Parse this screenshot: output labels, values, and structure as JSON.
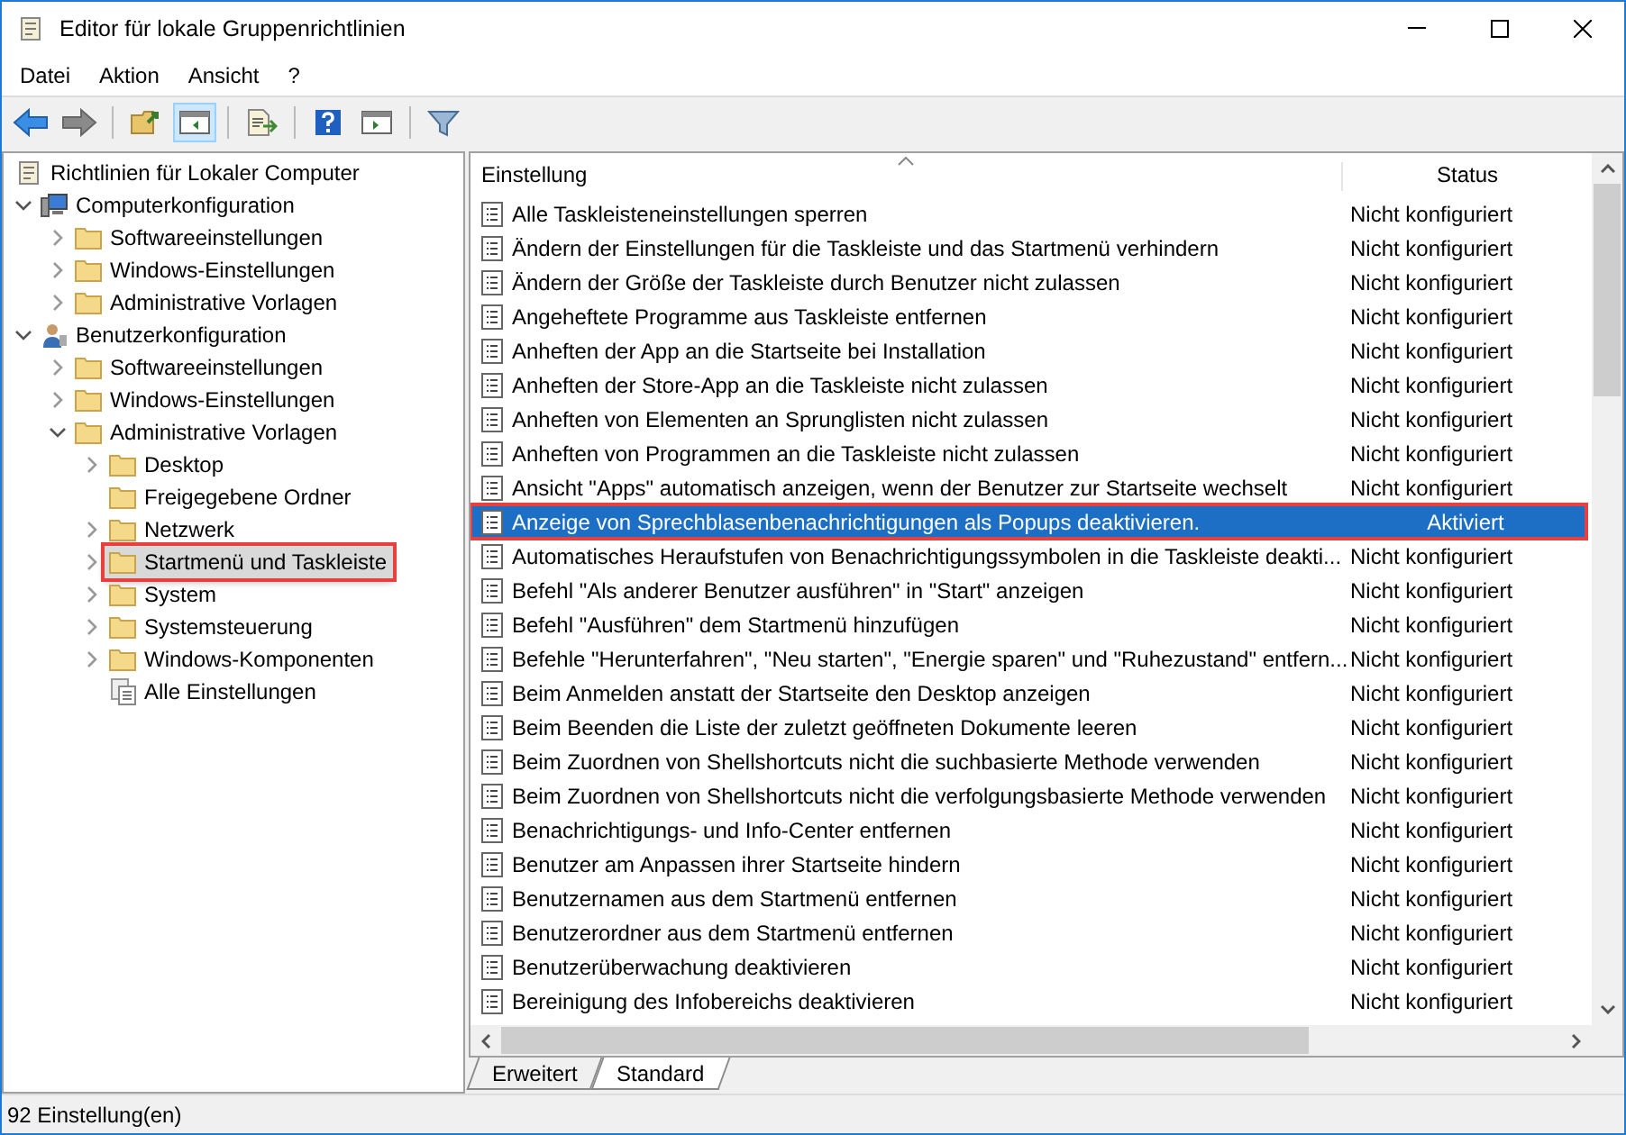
{
  "window": {
    "title": "Editor für lokale Gruppenrichtlinien"
  },
  "menu": [
    "Datei",
    "Aktion",
    "Ansicht",
    "?"
  ],
  "toolbar": [
    {
      "kind": "back",
      "pressed": false
    },
    {
      "kind": "forward",
      "pressed": false
    },
    {
      "kind": "up",
      "pressed": false
    },
    {
      "kind": "tree",
      "pressed": true
    },
    {
      "kind": "export",
      "pressed": false
    },
    {
      "kind": "help",
      "pressed": false
    },
    {
      "kind": "pane",
      "pressed": false
    },
    {
      "kind": "filter",
      "pressed": false
    }
  ],
  "tree": [
    {
      "label": "Richtlinien für Lokaler Computer",
      "kind": "policy",
      "selected": false,
      "children": [
        {
          "label": "Computerkonfiguration",
          "kind": "computer",
          "expandable": true,
          "expanded": true,
          "selected": false,
          "children": [
            {
              "label": "Softwareeinstellungen",
              "kind": "folder",
              "expandable": true,
              "expanded": false,
              "selected": false
            },
            {
              "label": "Windows-Einstellungen",
              "kind": "folder",
              "expandable": true,
              "expanded": false,
              "selected": false
            },
            {
              "label": "Administrative Vorlagen",
              "kind": "folder",
              "expandable": true,
              "expanded": false,
              "selected": false
            }
          ]
        },
        {
          "label": "Benutzerkonfiguration",
          "kind": "user",
          "expandable": true,
          "expanded": true,
          "selected": false,
          "children": [
            {
              "label": "Softwareeinstellungen",
              "kind": "folder",
              "expandable": true,
              "expanded": false,
              "selected": false
            },
            {
              "label": "Windows-Einstellungen",
              "kind": "folder",
              "expandable": true,
              "expanded": false,
              "selected": false
            },
            {
              "label": "Administrative Vorlagen",
              "kind": "folder",
              "expandable": true,
              "expanded": true,
              "selected": false,
              "children": [
                {
                  "label": "Desktop",
                  "kind": "folder",
                  "expandable": true,
                  "expanded": false,
                  "selected": false
                },
                {
                  "label": "Freigegebene Ordner",
                  "kind": "folder",
                  "expandable": false,
                  "expanded": false,
                  "selected": false
                },
                {
                  "label": "Netzwerk",
                  "kind": "folder",
                  "expandable": true,
                  "expanded": false,
                  "selected": false
                },
                {
                  "label": "Startmenü und Taskleiste",
                  "kind": "folder",
                  "expandable": true,
                  "expanded": false,
                  "selected": true
                },
                {
                  "label": "System",
                  "kind": "folder",
                  "expandable": true,
                  "expanded": false,
                  "selected": false
                },
                {
                  "label": "Systemsteuerung",
                  "kind": "folder",
                  "expandable": true,
                  "expanded": false,
                  "selected": false
                },
                {
                  "label": "Windows-Komponenten",
                  "kind": "folder",
                  "expandable": true,
                  "expanded": false,
                  "selected": false
                },
                {
                  "label": "Alle Einstellungen",
                  "kind": "settings",
                  "expandable": false,
                  "expanded": false,
                  "selected": false
                }
              ]
            }
          ]
        }
      ]
    }
  ],
  "table": {
    "columns": [
      "Einstellung",
      "Status"
    ],
    "rows": [
      {
        "setting": "Alle Taskleisteneinstellungen sperren",
        "status": "Nicht konfiguriert",
        "selected": false
      },
      {
        "setting": "Ändern der Einstellungen für die Taskleiste und das Startmenü verhindern",
        "status": "Nicht konfiguriert",
        "selected": false
      },
      {
        "setting": "Ändern der Größe der Taskleiste durch Benutzer nicht zulassen",
        "status": "Nicht konfiguriert",
        "selected": false
      },
      {
        "setting": "Angeheftete Programme aus Taskleiste entfernen",
        "status": "Nicht konfiguriert",
        "selected": false
      },
      {
        "setting": "Anheften der App an die Startseite bei Installation",
        "status": "Nicht konfiguriert",
        "selected": false
      },
      {
        "setting": "Anheften der Store-App an die Taskleiste nicht zulassen",
        "status": "Nicht konfiguriert",
        "selected": false
      },
      {
        "setting": "Anheften von Elementen an Sprunglisten nicht zulassen",
        "status": "Nicht konfiguriert",
        "selected": false
      },
      {
        "setting": "Anheften von Programmen an die Taskleiste nicht zulassen",
        "status": "Nicht konfiguriert",
        "selected": false
      },
      {
        "setting": "Ansicht \"Apps\" automatisch anzeigen, wenn der Benutzer zur Startseite wechselt",
        "status": "Nicht konfiguriert",
        "selected": false
      },
      {
        "setting": "Anzeige von Sprechblasenbenachrichtigungen als Popups deaktivieren.",
        "status": "Aktiviert",
        "selected": true
      },
      {
        "setting": "Automatisches Heraufstufen von Benachrichtigungssymbolen in die Taskleiste deakti...",
        "status": "Nicht konfiguriert",
        "selected": false
      },
      {
        "setting": "Befehl \"Als anderer Benutzer ausführen\" in \"Start\" anzeigen",
        "status": "Nicht konfiguriert",
        "selected": false
      },
      {
        "setting": "Befehl \"Ausführen\" dem Startmenü hinzufügen",
        "status": "Nicht konfiguriert",
        "selected": false
      },
      {
        "setting": "Befehle \"Herunterfahren\", \"Neu starten\", \"Energie sparen\" und \"Ruhezustand\" entfern...",
        "status": "Nicht konfiguriert",
        "selected": false
      },
      {
        "setting": "Beim Anmelden anstatt der Startseite den Desktop anzeigen",
        "status": "Nicht konfiguriert",
        "selected": false
      },
      {
        "setting": "Beim Beenden die Liste der zuletzt geöffneten Dokumente leeren",
        "status": "Nicht konfiguriert",
        "selected": false
      },
      {
        "setting": "Beim Zuordnen von Shellshortcuts nicht die suchbasierte Methode verwenden",
        "status": "Nicht konfiguriert",
        "selected": false
      },
      {
        "setting": "Beim Zuordnen von Shellshortcuts nicht die verfolgungsbasierte Methode verwenden",
        "status": "Nicht konfiguriert",
        "selected": false
      },
      {
        "setting": "Benachrichtigungs- und Info-Center entfernen",
        "status": "Nicht konfiguriert",
        "selected": false
      },
      {
        "setting": "Benutzer am Anpassen ihrer Startseite hindern",
        "status": "Nicht konfiguriert",
        "selected": false
      },
      {
        "setting": "Benutzernamen aus dem Startmenü entfernen",
        "status": "Nicht konfiguriert",
        "selected": false
      },
      {
        "setting": "Benutzerordner aus dem Startmenü entfernen",
        "status": "Nicht konfiguriert",
        "selected": false
      },
      {
        "setting": "Benutzerüberwachung deaktivieren",
        "status": "Nicht konfiguriert",
        "selected": false
      },
      {
        "setting": "Bereinigung des Infobereichs deaktivieren",
        "status": "Nicht konfiguriert",
        "selected": false
      }
    ]
  },
  "view_tabs": [
    {
      "label": "Erweitert",
      "selected": false
    },
    {
      "label": "Standard",
      "selected": true
    }
  ],
  "status_bar": "92 Einstellung(en)"
}
